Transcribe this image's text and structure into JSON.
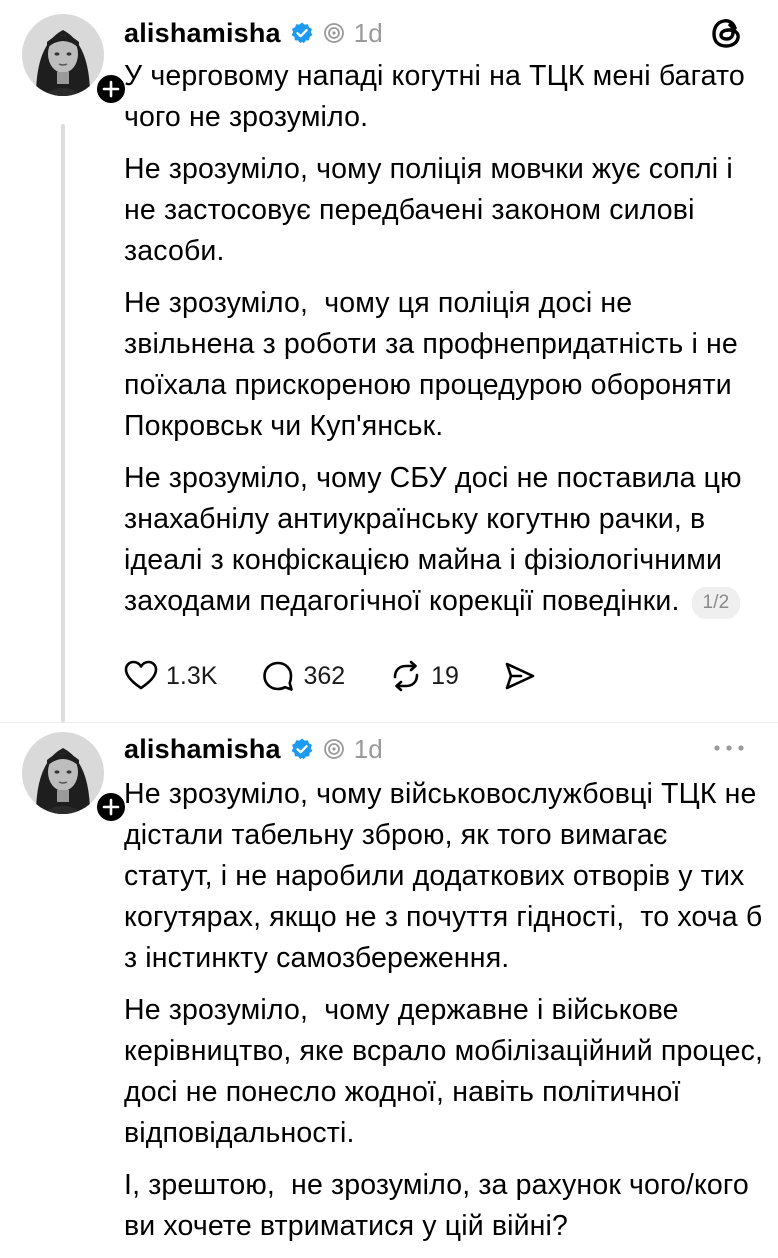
{
  "colors": {
    "verified": "#1d9bf0",
    "muted": "#9a9a9a",
    "thread_line": "#dcdcdc"
  },
  "posts": [
    {
      "username": "alishamisha",
      "timestamp": "1d",
      "corner_icon": "threads-logo-icon",
      "paragraphs": [
        "У черговому нападі когутні на ТЦК мені багато чого не зрозуміло.",
        "Не зрозуміло, чому поліція мовчки жує соплі і не застосовує передбачені законом силові засоби.",
        "Не зрозуміло,  чому ця поліція досі не звільнена з роботи за профнепридатність і не поїхала прискореною процедурою обороняти Покровськ чи Куп'янськ.",
        "Не зрозуміло, чому СБУ досі не поставила цю знахабнілу антиукраїнську когутню рачки, в ідеалі з конфіскацією майна і фізіологічними заходами педагогічної корекції поведінки."
      ],
      "page_indicator": "1/2",
      "actions": {
        "likes": "1.3K",
        "replies": "362",
        "reposts": "19"
      }
    },
    {
      "username": "alishamisha",
      "timestamp": "1d",
      "corner_icon": "more-options-icon",
      "paragraphs": [
        "Не зрозуміло, чому військовослужбовці ТЦК не дістали табельну зброю, як того вимагає статут, і не наробили додаткових отворів у тих когутярах, якщо не з почуття гідності,  то хоча б з інстинкту самозбереження.",
        "Не зрозуміло,  чому державне і військове керівництво, яке всрало мобілізаційний процес, досі не понесло жодної, навіть політичної відповідальності.",
        "І, зрештою,  не зрозуміло, за рахунок чого/кого ви хочете втриматися у цій війні?"
      ]
    }
  ]
}
